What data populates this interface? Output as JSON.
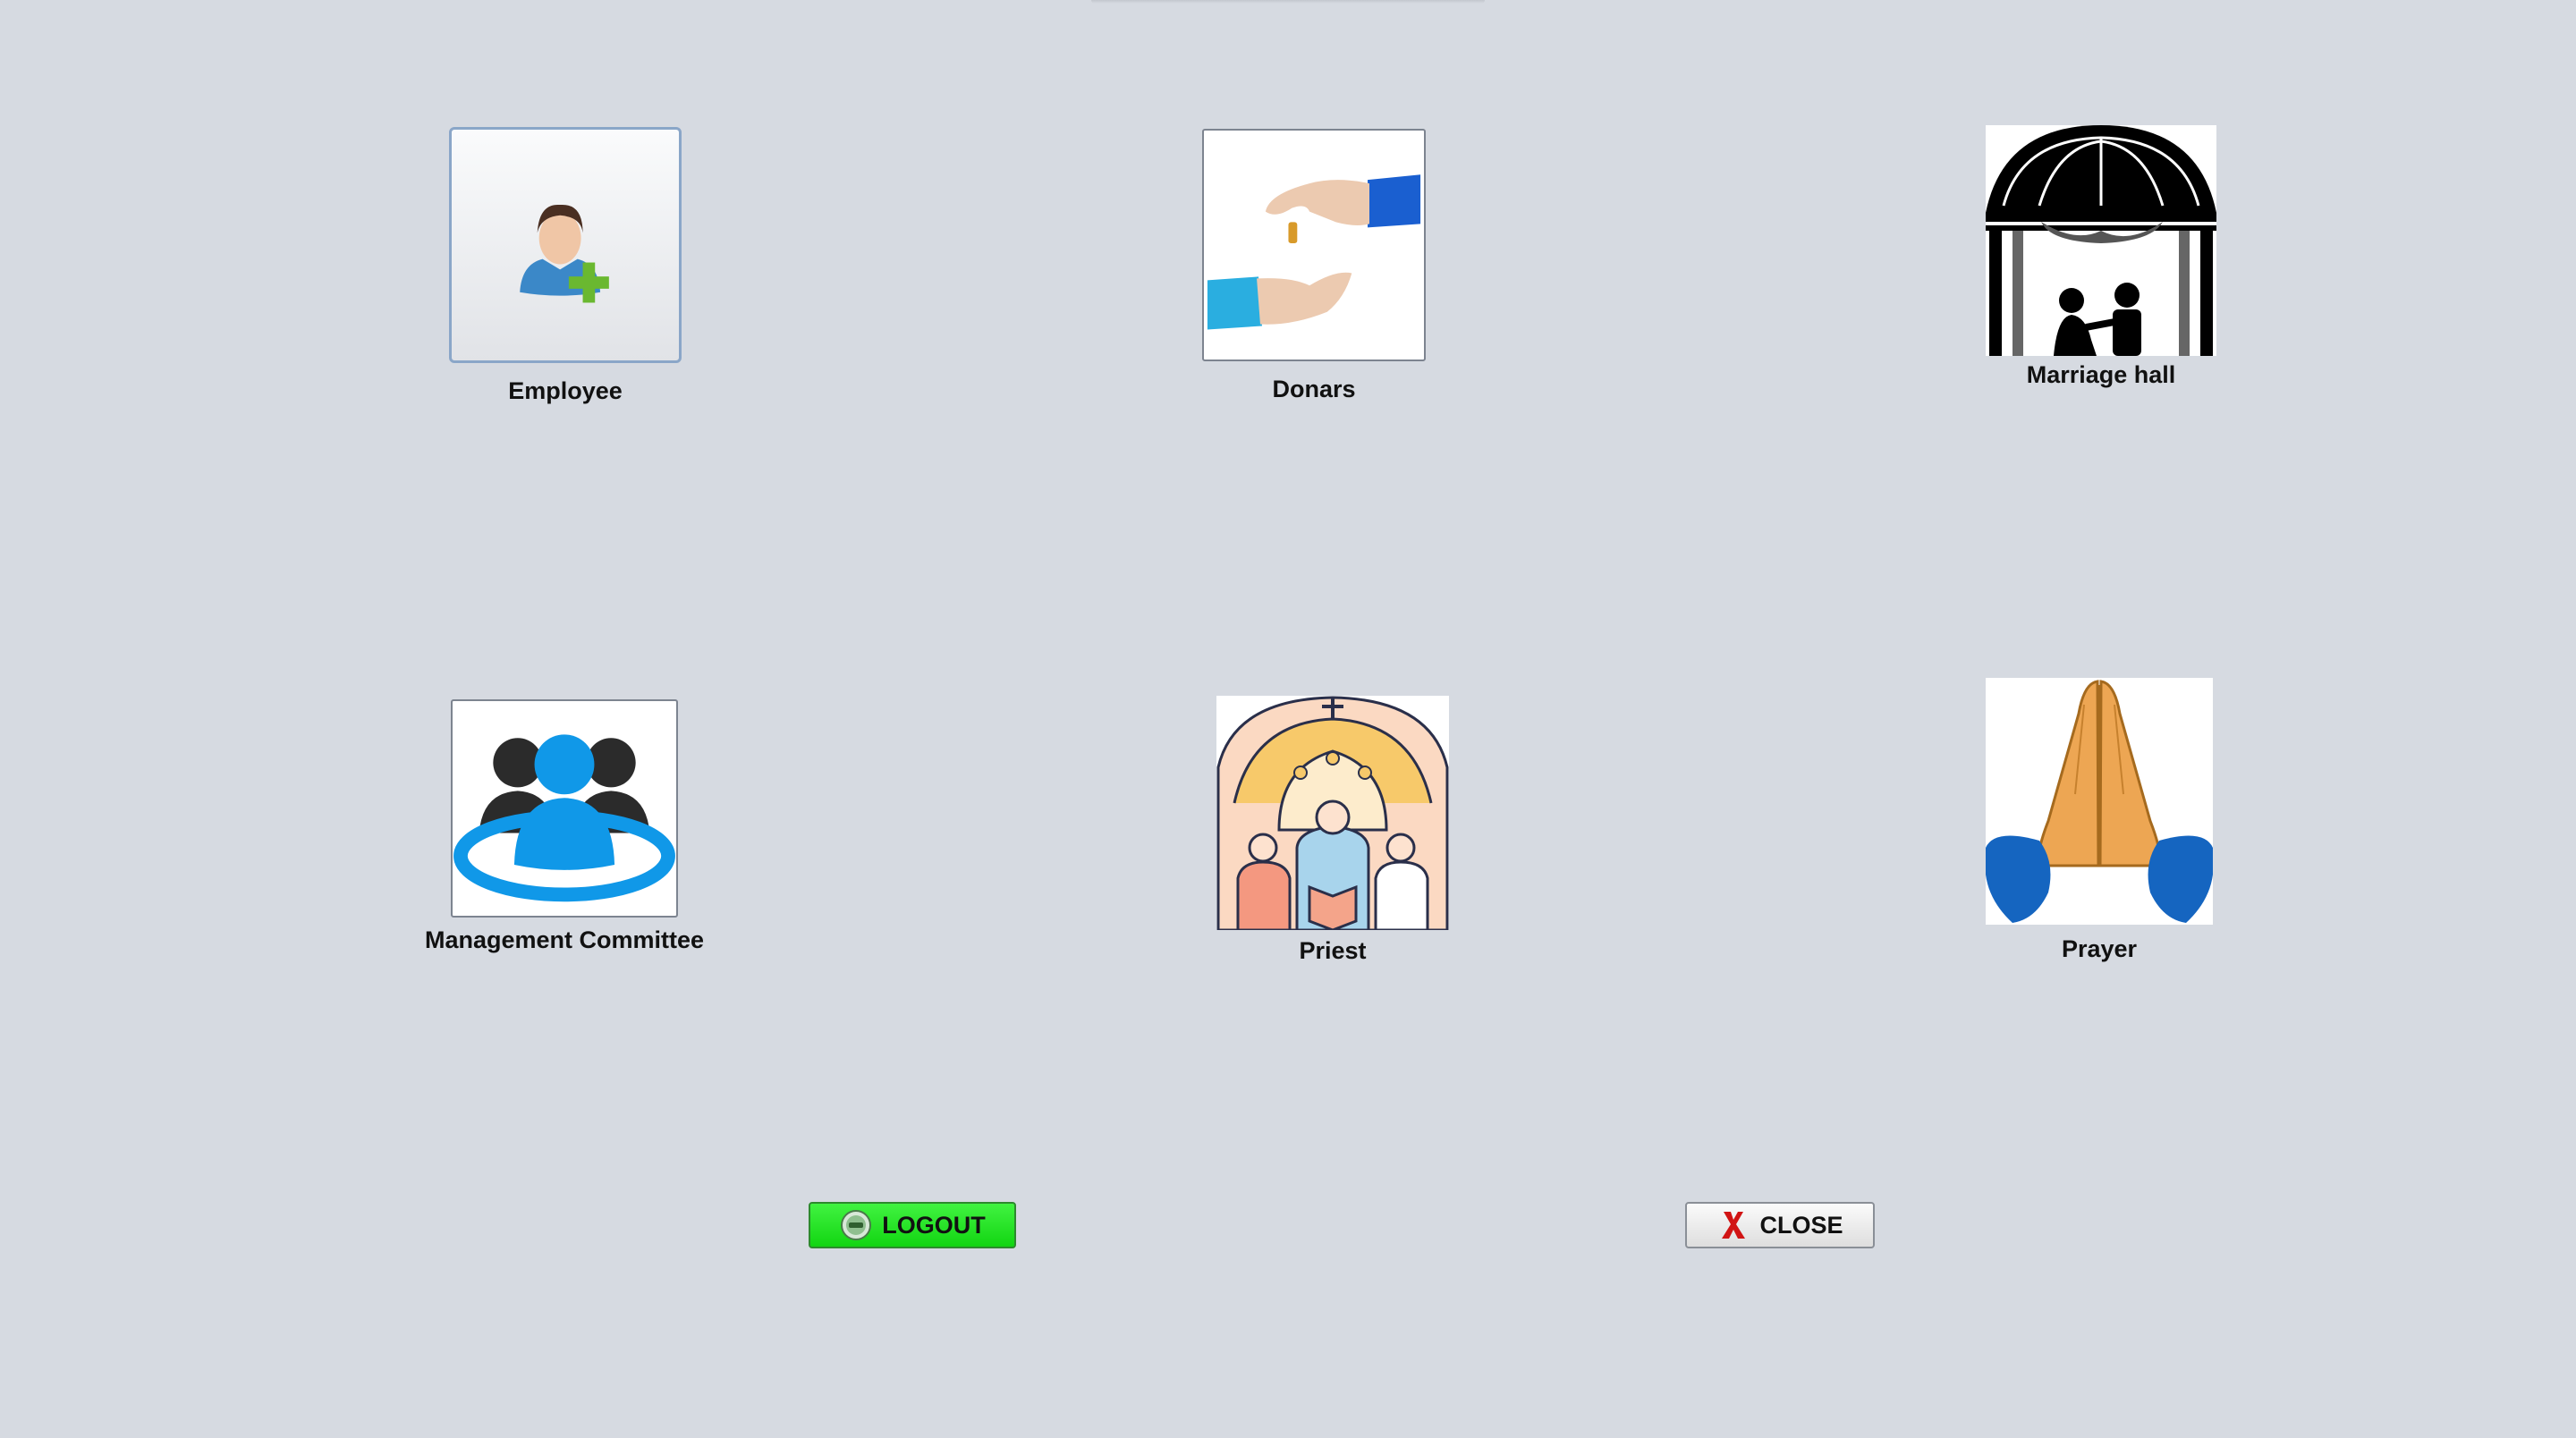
{
  "tiles": {
    "employee": {
      "label": "Employee"
    },
    "donars": {
      "label": "Donars"
    },
    "marriage_hall": {
      "label": "Marriage hall"
    },
    "management_committee": {
      "label": "Management Committee"
    },
    "priest": {
      "label": "Priest"
    },
    "prayer": {
      "label": "Prayer"
    }
  },
  "actions": {
    "logout_label": "LOGOUT",
    "close_label": "CLOSE"
  },
  "colors": {
    "background": "#d6dae1",
    "logout_green": "#22e022",
    "close_x_red": "#d11414",
    "committee_blue": "#1098e8"
  }
}
